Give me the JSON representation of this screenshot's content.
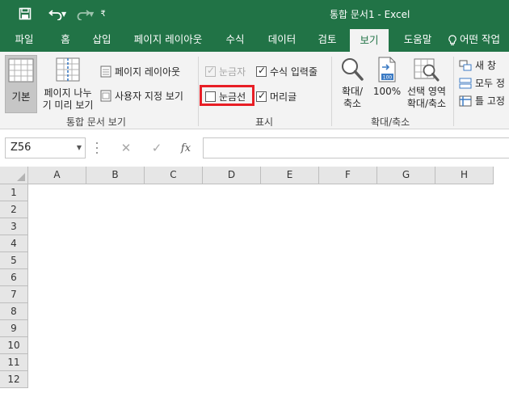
{
  "window": {
    "title": "통합 문서1  -  Excel"
  },
  "qat": {
    "save_icon": "save-icon",
    "undo_icon": "undo-icon",
    "redo_icon": "redo-icon",
    "more_glyph": "₹"
  },
  "tabs": [
    {
      "label": "파일"
    },
    {
      "label": "홈"
    },
    {
      "label": "삽입"
    },
    {
      "label": "페이지 레이아웃"
    },
    {
      "label": "수식"
    },
    {
      "label": "데이터"
    },
    {
      "label": "검토"
    },
    {
      "label": "보기",
      "active": true
    },
    {
      "label": "도움말"
    },
    {
      "label": "어떤 작업"
    }
  ],
  "ribbon": {
    "workbook_views": {
      "group_label": "통합 문서 보기",
      "normal": {
        "label": "기본"
      },
      "page_break": {
        "line1": "페이지 나누",
        "line2": "기 미리 보기"
      },
      "page_layout": {
        "label": "페이지 레이아웃"
      },
      "custom_views": {
        "label": "사용자 지정 보기"
      }
    },
    "show": {
      "group_label": "표시",
      "ruler": {
        "label": "눈금자",
        "checked": true,
        "disabled": true
      },
      "formula_bar": {
        "label": "수식 입력줄",
        "checked": true
      },
      "gridlines": {
        "label": "눈금선",
        "checked": false
      },
      "headings": {
        "label": "머리글",
        "checked": true
      }
    },
    "zoom": {
      "group_label": "확대/축소",
      "zoom": {
        "line1": "확대/",
        "line2": "축소"
      },
      "hundred": {
        "label": "100%"
      },
      "selection": {
        "line1": "선택 영역",
        "line2": "확대/축소"
      }
    },
    "window": {
      "new_window": {
        "label": "새 창"
      },
      "arrange_all": {
        "label": "모두 정"
      },
      "freeze": {
        "label": "틀 고정"
      }
    }
  },
  "formula_bar": {
    "name_box": "Z56",
    "cancel": "✕",
    "enter": "✓",
    "fx": "fx",
    "value": ""
  },
  "columns": [
    "A",
    "B",
    "C",
    "D",
    "E",
    "F",
    "G",
    "H"
  ],
  "rows": [
    "1",
    "2",
    "3",
    "4",
    "5",
    "6",
    "7",
    "8",
    "9",
    "10",
    "11",
    "12"
  ],
  "colors": {
    "brand": "#217346",
    "ribbon_bg": "#f3f3f3",
    "highlight": "#e81e25",
    "header_bg": "#e6e6e6"
  }
}
